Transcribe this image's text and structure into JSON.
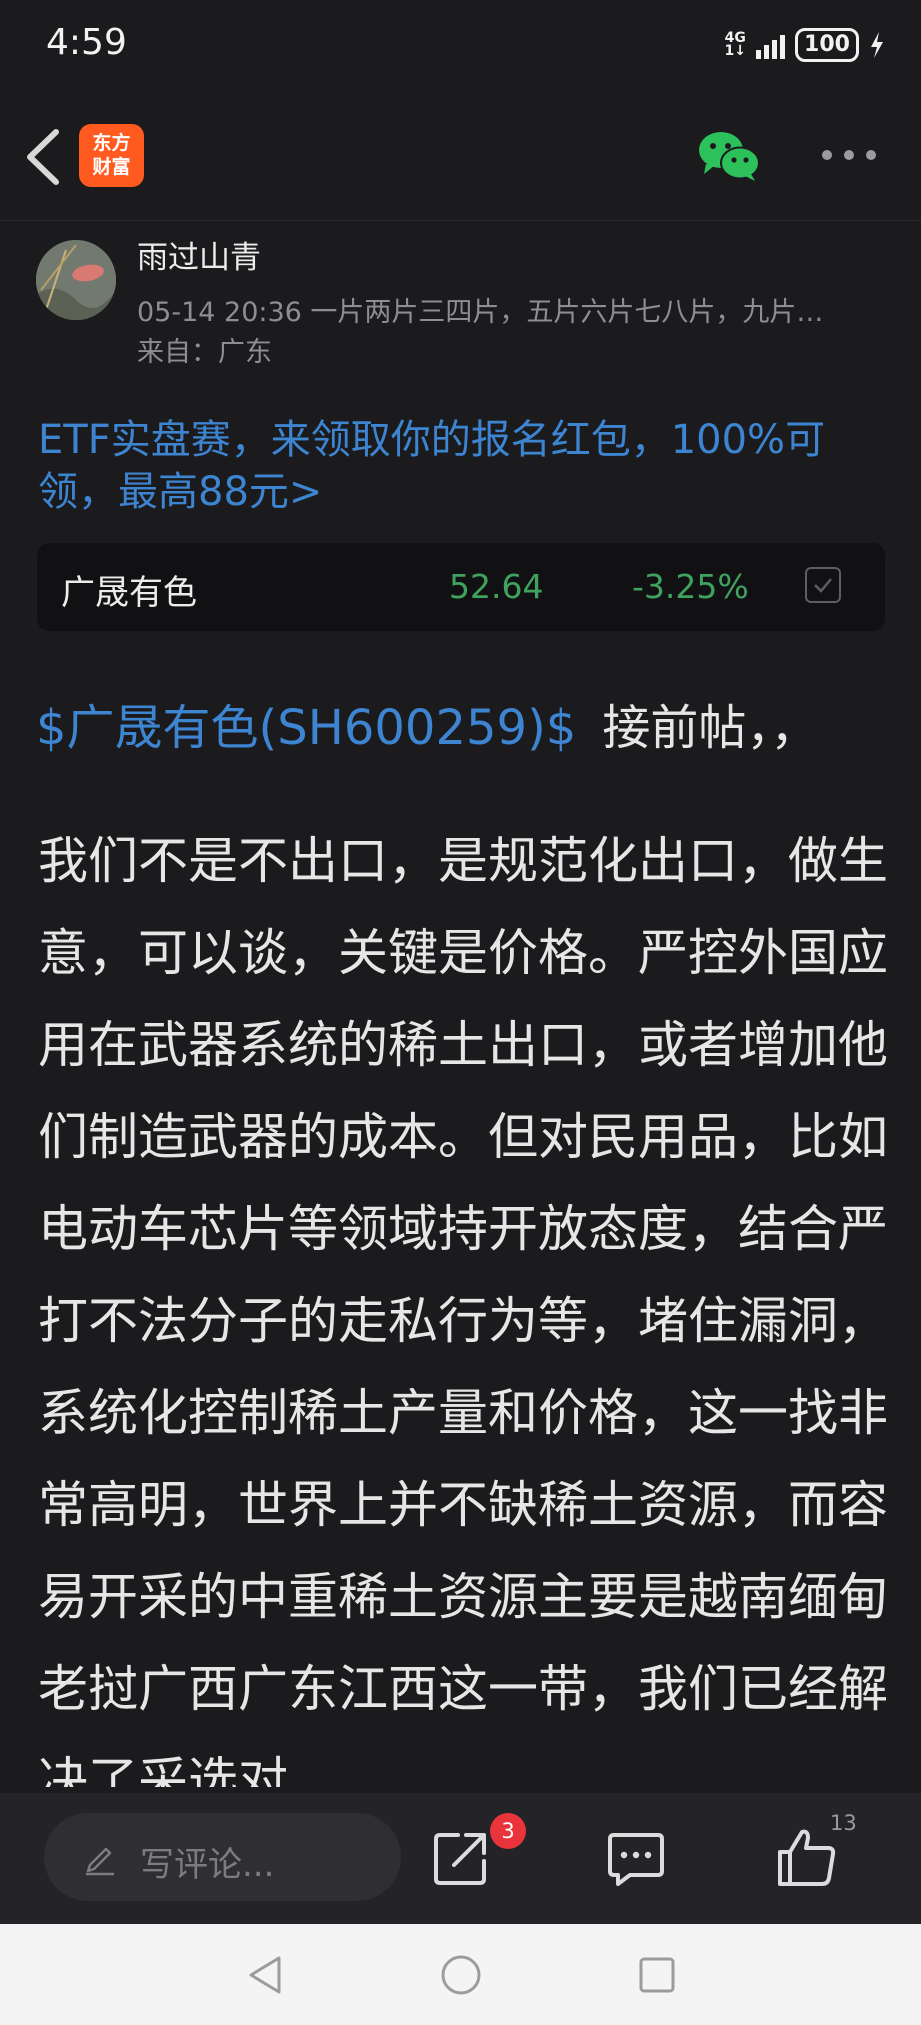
{
  "status_bar": {
    "time": "4:59",
    "network_type": "4G",
    "network_sub": "1↓",
    "battery": "100"
  },
  "nav": {
    "logo_line1": "东方",
    "logo_line2": "财富",
    "icons": [
      "back-icon",
      "wechat-icon",
      "more-icon"
    ]
  },
  "author": {
    "name": "雨过山青",
    "meta": "05-14 20:36 一片两片三四片，五片六片七八片，九片…",
    "location": "来自：广东"
  },
  "promo": {
    "text": "ETF实盘赛，来领取你的报名红包，100%可领，最高88元>"
  },
  "stock_card": {
    "name": "广晟有色",
    "price": "52.64",
    "change": "-3.25%",
    "change_color": "#3fa35f"
  },
  "post": {
    "stock_link": "$广晟有色(SH600259)$",
    "lead_text": "接前帖，，",
    "body": "我们不是不出口，是规范化出口，做生意，可以谈，关键是价格。严控外国应用在武器系统的稀土出口，或者增加他们制造武器的成本。但对民用品，比如电动车芯片等领域持开放态度，结合严打不法分子的走私行为等，堵住漏洞，系统化控制稀土产量和价格，这一找非常高明，世界上并不缺稀土资源，而容易开采的中重稀土资源主要是越南缅甸老挝广西广东江西这一带，我们已经解决了采选对"
  },
  "action_bar": {
    "comment_placeholder": "写评论...",
    "share_badge": "3",
    "like_count": "13"
  },
  "colors": {
    "background": "#1b1b1e",
    "link_blue": "#3d84d1",
    "down_green": "#3fa35f",
    "brand_orange": "#ff5a1f",
    "wechat_green": "#2dc15b",
    "badge_red": "#e8343a"
  }
}
